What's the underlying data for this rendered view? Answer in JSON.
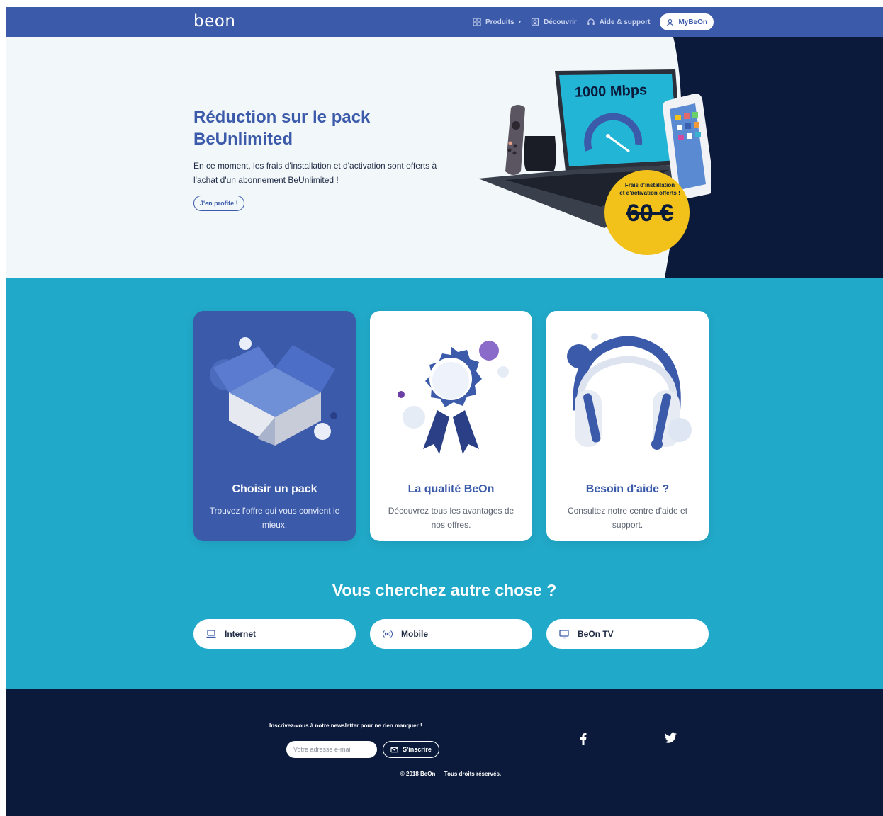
{
  "nav": {
    "logo": "beon",
    "links": [
      {
        "label": "Produits",
        "icon": "grid-icon"
      },
      {
        "label": "Découvrir",
        "icon": "discover-icon"
      },
      {
        "label": "Aide & support",
        "icon": "headset-icon"
      }
    ],
    "account_label": "MyBeOn"
  },
  "hero": {
    "title": "Réduction sur le pack BeUnlimited",
    "description": "En ce moment, les frais d'installation et d'activation sont offerts à l'achat d'un abonnement BeUnlimited !",
    "cta": "J'en profite !",
    "screen_text": "1000 Mbps",
    "badge_line1": "Frais d'installation",
    "badge_line2": "et d'activation offerts !",
    "badge_price": "60 €"
  },
  "cards": [
    {
      "title": "Choisir un pack",
      "description": "Trouvez l'offre qui vous convient le mieux.",
      "icon": "box-icon"
    },
    {
      "title": "La qualité BeOn",
      "description": "Découvrez tous les avantages de nos offres.",
      "icon": "award-icon"
    },
    {
      "title": "Besoin d'aide ?",
      "description": "Consultez notre centre d'aide et support.",
      "icon": "headphones-icon"
    }
  ],
  "other": {
    "title": "Vous cherchez autre chose ?",
    "items": [
      {
        "label": "Internet",
        "icon": "laptop-icon"
      },
      {
        "label": "Mobile",
        "icon": "signal-icon"
      },
      {
        "label": "BeOn TV",
        "icon": "tv-icon"
      }
    ]
  },
  "footer": {
    "newsletter_label": "Inscrivez-vous à notre newsletter pour ne rien manquer !",
    "email_placeholder": "Votre adresse e-mail",
    "subscribe_label": "S'inscrire",
    "copyright": "© 2018 BeOn — Tous droits réservés.",
    "social": [
      "facebook-icon",
      "twitter-icon"
    ]
  },
  "colors": {
    "brand": "#3b5aa9",
    "teal": "#21a9c9",
    "navy": "#0b1a3a",
    "yellow": "#f2c21b"
  }
}
